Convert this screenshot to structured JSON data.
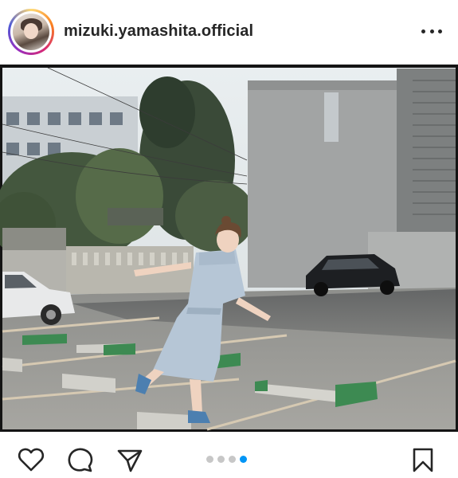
{
  "post": {
    "username": "mizuki.yamashita.official",
    "carousel": {
      "total_slides": 4,
      "active_slide": 4
    }
  },
  "icons": {
    "more": "more-horizontal-icon",
    "like": "heart-icon",
    "comment": "comment-bubble-icon",
    "share": "send-paper-plane-icon",
    "save": "bookmark-icon"
  },
  "colors": {
    "text": "#262626",
    "carousel_active": "#0095f6",
    "carousel_inactive": "#c7c7c7",
    "avatar_ring": [
      "#feda75",
      "#fa7e1e",
      "#d62976",
      "#962fbf",
      "#4f5bd5"
    ]
  }
}
